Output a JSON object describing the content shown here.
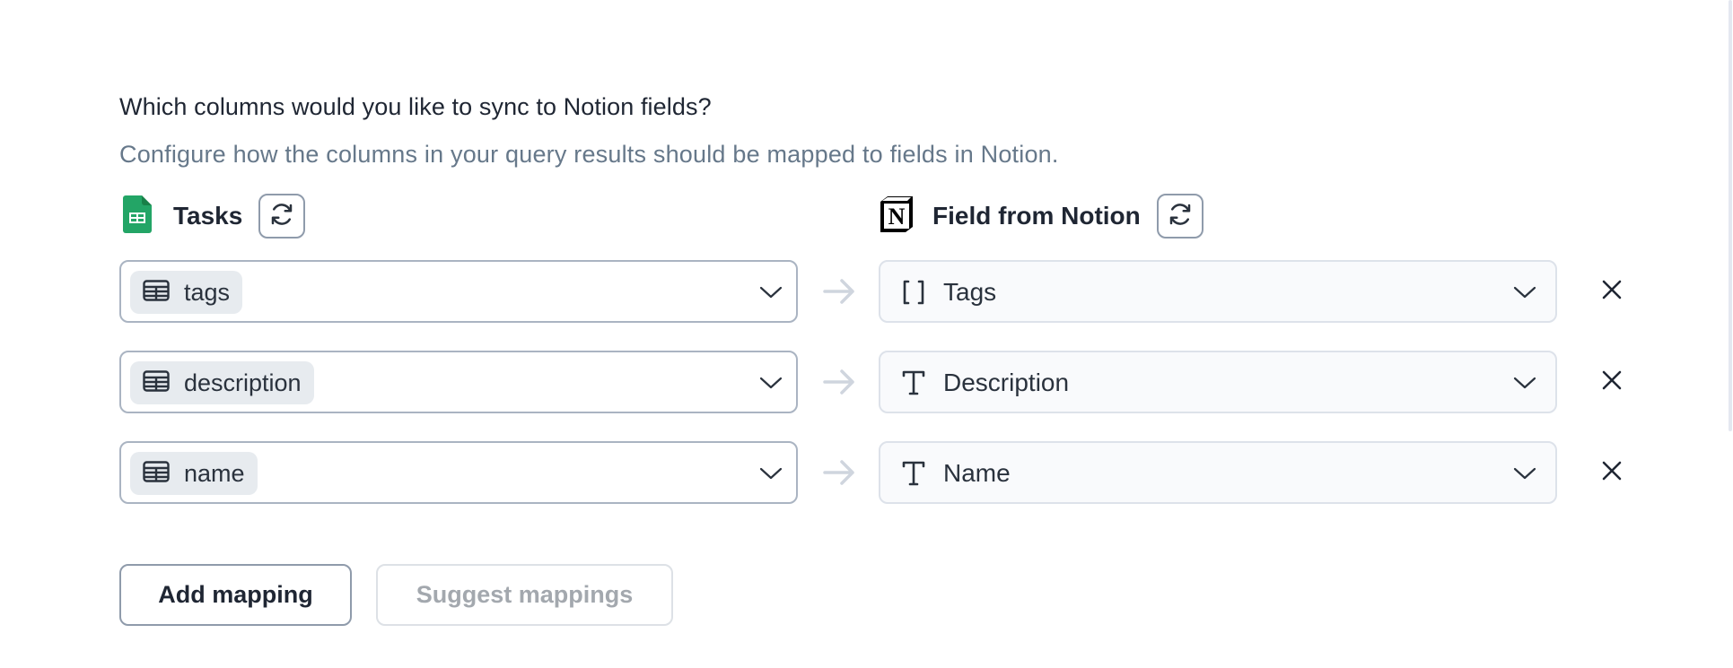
{
  "header": {
    "title": "Which columns would you like to sync to Notion fields?",
    "subtitle": "Configure how the columns in your query results should be mapped to fields in Notion."
  },
  "source": {
    "title": "Tasks",
    "icon": "google-sheets-icon",
    "refresh_icon": "refresh-icon"
  },
  "target": {
    "title": "Field from Notion",
    "icon": "notion-logo-icon",
    "refresh_icon": "refresh-icon"
  },
  "mappings": [
    {
      "source_column": "tags",
      "source_icon": "table-icon",
      "target_field": "Tags",
      "target_type_icon": "array-brackets-icon"
    },
    {
      "source_column": "description",
      "source_icon": "table-icon",
      "target_field": "Description",
      "target_type_icon": "text-type-icon"
    },
    {
      "source_column": "name",
      "source_icon": "table-icon",
      "target_field": "Name",
      "target_type_icon": "text-type-icon"
    }
  ],
  "buttons": {
    "add_mapping": "Add mapping",
    "suggest_mappings": "Suggest mappings"
  },
  "colors": {
    "sheets_green": "#23a566",
    "text_primary": "#1f2633",
    "text_muted": "#66788a",
    "border": "#aab4c2",
    "disabled_text": "#a3a8ae"
  }
}
